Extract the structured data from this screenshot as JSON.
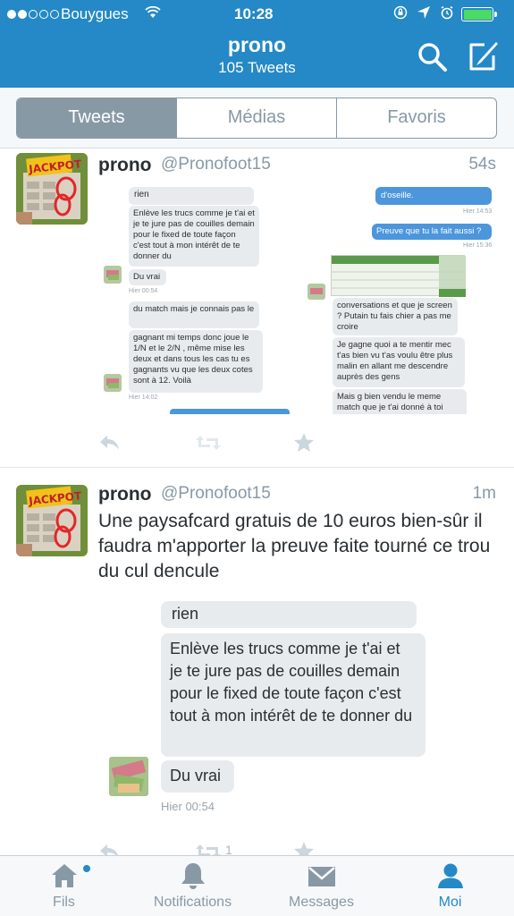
{
  "status_bar": {
    "carrier": "Bouygues",
    "time": "10:28",
    "battery_color": "#4cd964"
  },
  "header": {
    "title": "prono",
    "subtitle": "105 Tweets",
    "background": "#2489c6"
  },
  "segments": {
    "items": [
      "Tweets",
      "Médias",
      "Favoris"
    ],
    "selected": "Tweets"
  },
  "tweets": [
    {
      "name": "prono",
      "handle": "@Pronofoot15",
      "time": "54s",
      "text": "",
      "media": {
        "left_column": [
          {
            "text": "rien"
          },
          {
            "text": "Enlève les trucs comme je t'ai et je te jure pas de couilles demain pour le fixed de toute façon c'est tout à mon intérêt de te donner du"
          },
          {
            "text": "Du vrai"
          },
          {
            "meta": "Hier 00:54"
          },
          {
            "text": "du match mais je connais pas le"
          },
          {
            "text": "gagnant mi temps donc joue le 1/N et le 2/N , même mise les deux et dans tous les cas tu es gagnants vu que les deux cotes sont à 12. Voilà"
          },
          {
            "meta": "Hier 14:02"
          }
        ],
        "right_column": [
          {
            "text": "d'oseille."
          },
          {
            "meta": "Hier 14:53"
          },
          {
            "text": "Preuve que tu la fait aussi ?"
          },
          {
            "meta": "Hier 15:36"
          },
          {
            "text": "conversations et que je screen ? Putain tu fais chier a pas me croire"
          },
          {
            "text": "Je gagne quoi a te mentir mec t'as bien vu t'as voulu être plus malin en allant me descendre auprès des gens"
          },
          {
            "text": "Mais g bien vendu le meme match que je t'ai donné à toi"
          }
        ]
      },
      "actions": {
        "reply_icon": "reply-icon",
        "retweet_icon": "retweet-icon",
        "favorite_icon": "star-icon",
        "retweet_count": "",
        "favorite_count": ""
      }
    },
    {
      "name": "prono",
      "handle": "@Pronofoot15",
      "time": "1m",
      "text": "Une paysafcard gratuis de 10 euros bien-sûr il faudra m'apporter la preuve faite tourné ce trou du cul dencule",
      "media": {
        "bubbles": [
          {
            "text": "rien"
          },
          {
            "text": "Enlève les trucs comme je t'ai et je te jure pas de couilles demain pour le fixed de toute façon c'est tout à mon intérêt de te donner du"
          },
          {
            "text": "Du vrai"
          }
        ],
        "meta": "Hier 00:54"
      },
      "actions": {
        "reply_icon": "reply-icon",
        "retweet_icon": "retweet-icon",
        "favorite_icon": "star-icon",
        "retweet_count": "1",
        "favorite_count": ""
      }
    }
  ],
  "tabbar": {
    "items": [
      {
        "label": "Fils",
        "icon": "home-icon"
      },
      {
        "label": "Notifications",
        "icon": "bell-icon"
      },
      {
        "label": "Messages",
        "icon": "envelope-icon"
      },
      {
        "label": "Moi",
        "icon": "person-icon"
      }
    ],
    "selected": "Moi",
    "accent": "#2489c6",
    "inactive": "#8899a6"
  }
}
